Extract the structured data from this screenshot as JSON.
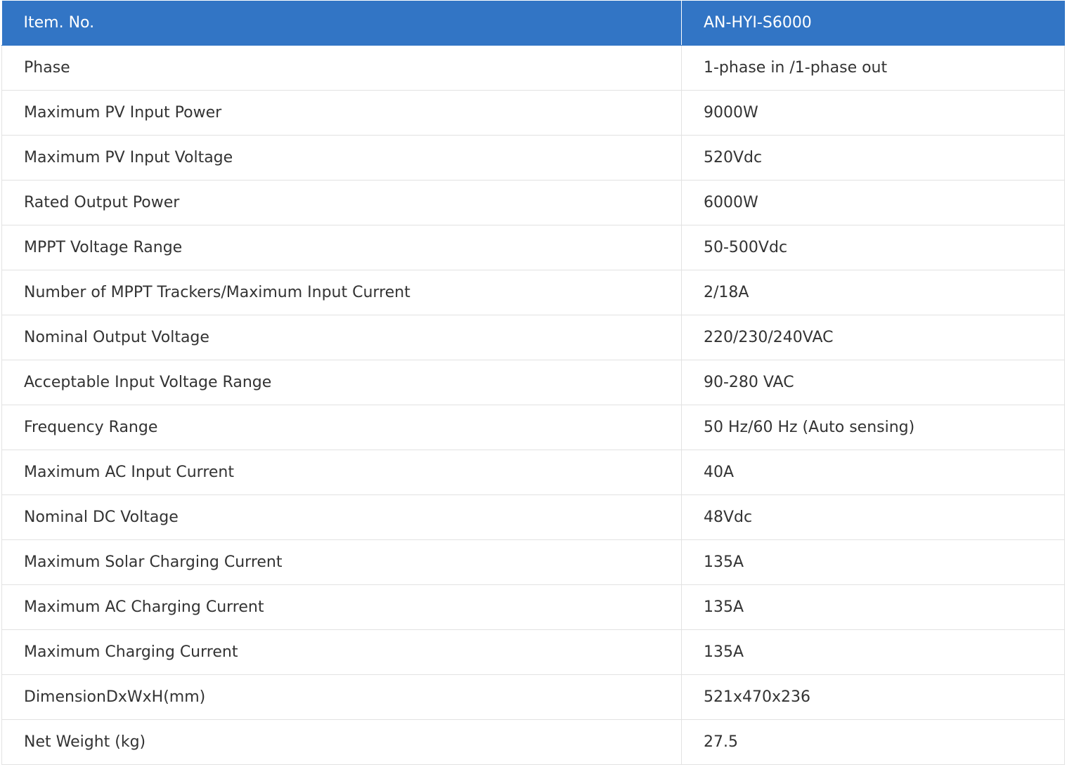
{
  "header": {
    "col1": "Item. No.",
    "col2": "AN-HYI-S6000"
  },
  "rows": [
    {
      "label": "Phase",
      "value": "1-phase in /1-phase out"
    },
    {
      "label": "Maximum PV Input Power",
      "value": "9000W"
    },
    {
      "label": "Maximum PV Input Voltage",
      "value": "520Vdc"
    },
    {
      "label": "Rated Output Power",
      "value": "6000W"
    },
    {
      "label": "MPPT Voltage Range",
      "value": "50-500Vdc"
    },
    {
      "label": "Number of MPPT Trackers/Maximum Input Current",
      "value": "2/18A"
    },
    {
      "label": "Nominal Output Voltage",
      "value": "220/230/240VAC"
    },
    {
      "label": "Acceptable Input Voltage Range",
      "value": "90-280 VAC"
    },
    {
      "label": "Frequency Range",
      "value": "50 Hz/60 Hz (Auto sensing)"
    },
    {
      "label": "Maximum AC Input Current",
      "value": "40A"
    },
    {
      "label": "Nominal DC Voltage",
      "value": "48Vdc"
    },
    {
      "label": "Maximum Solar Charging Current",
      "value": "135A"
    },
    {
      "label": "Maximum AC Charging Current",
      "value": "135A"
    },
    {
      "label": "Maximum Charging Current",
      "value": "135A"
    },
    {
      "label": "DimensionDxWxH(mm)",
      "value": "521x470x236"
    },
    {
      "label": "Net Weight (kg)",
      "value": "27.5"
    }
  ],
  "colors": {
    "header_bg": "#3275c5",
    "header_text": "#ffffff",
    "body_text": "#333333",
    "border": "#e2e2e2"
  }
}
